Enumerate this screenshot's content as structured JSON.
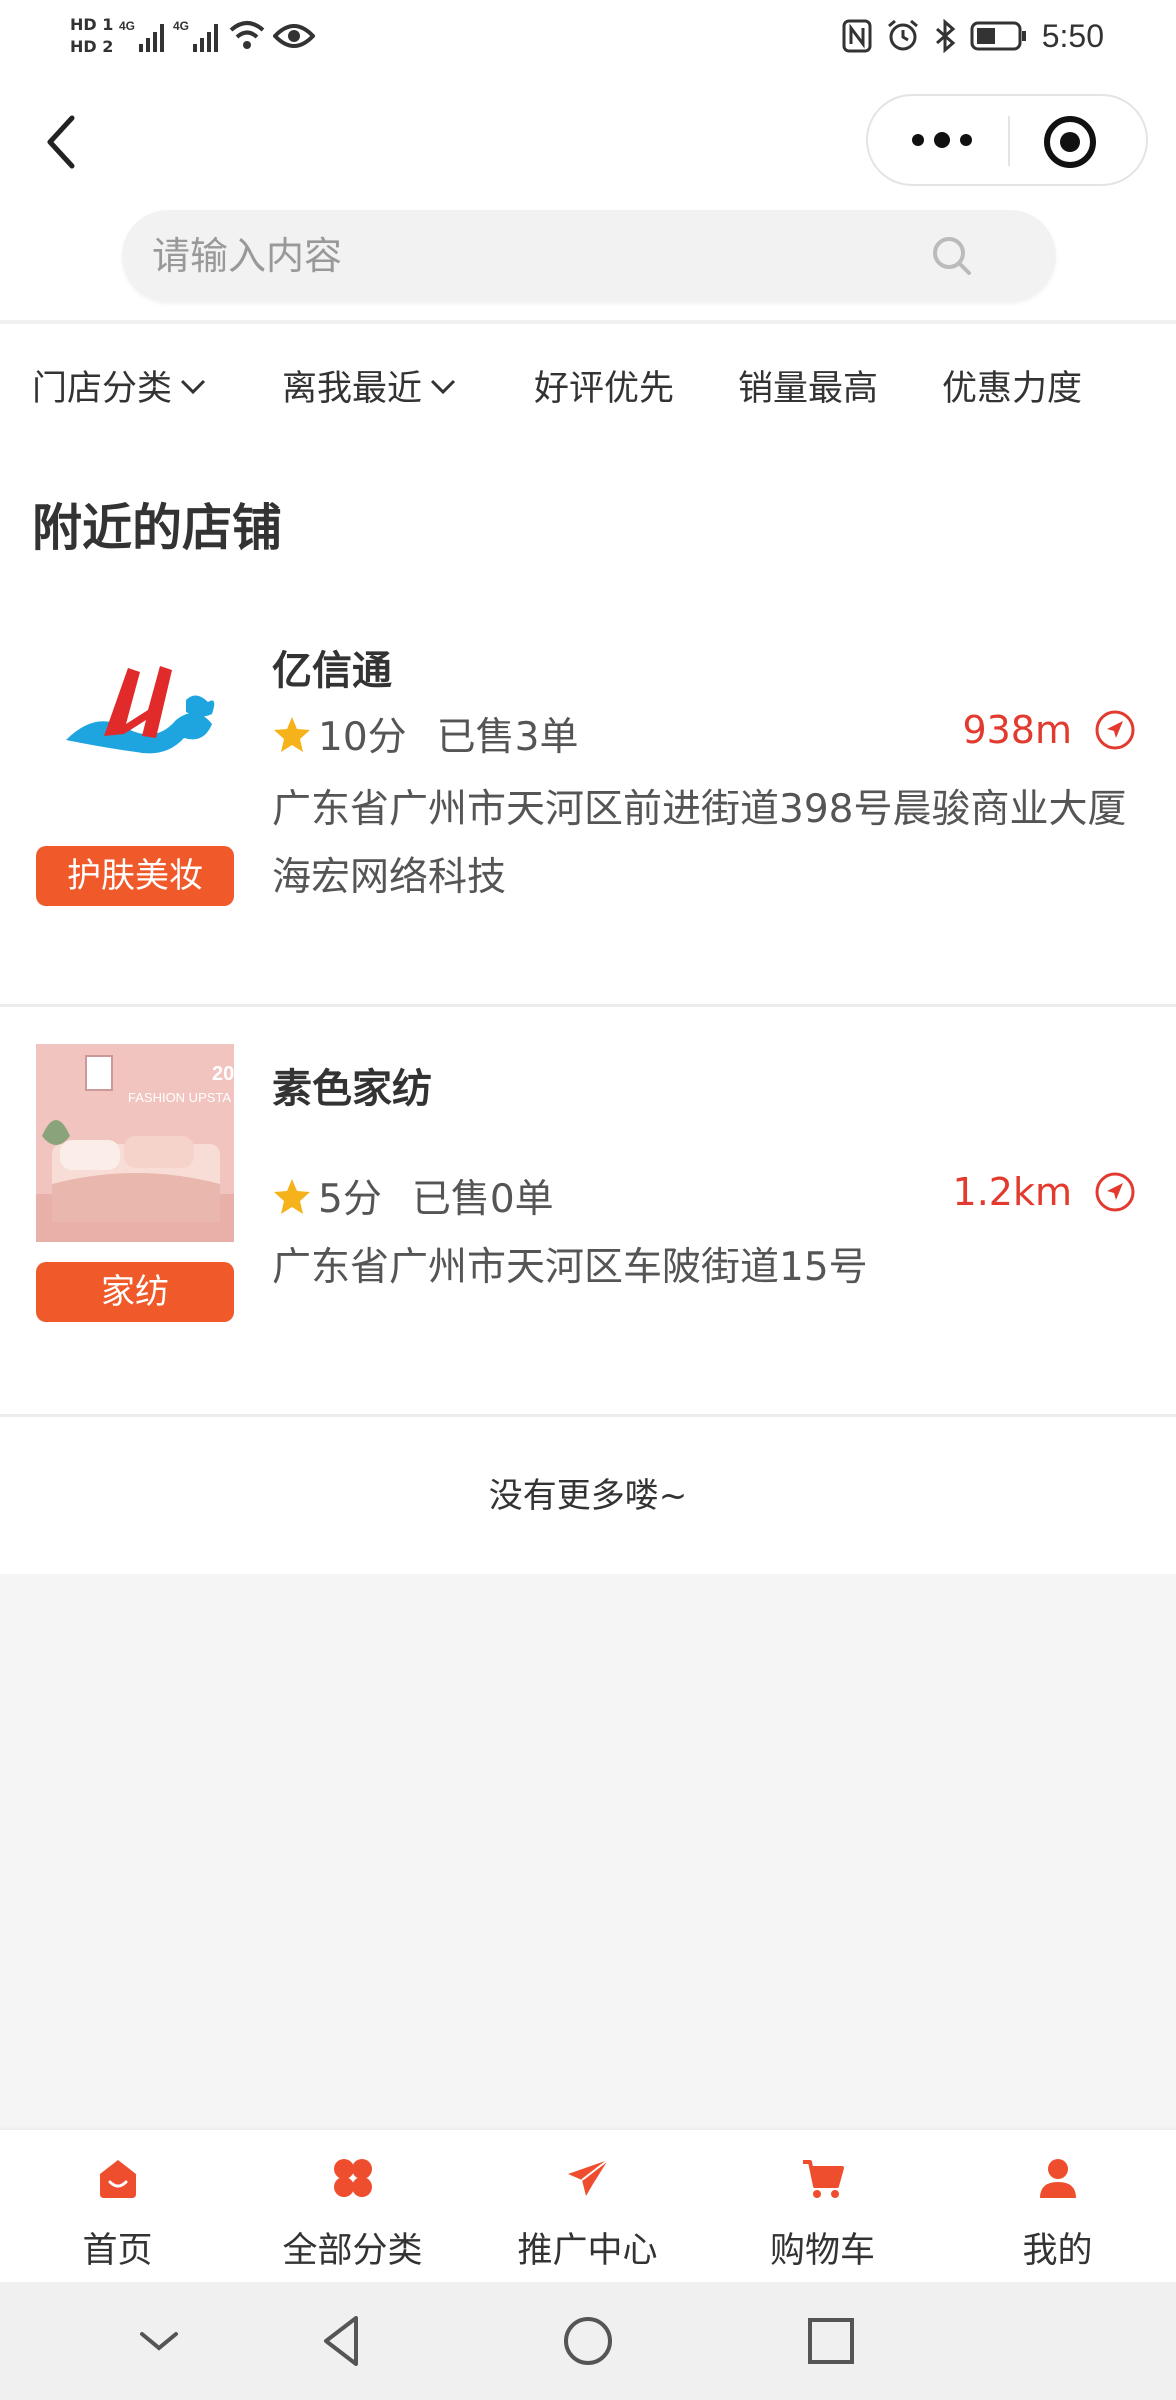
{
  "status_bar": {
    "sim1": "HD 1",
    "sim2": "HD 2",
    "signal1": "4G",
    "signal2": "4G",
    "time": "5:50",
    "icons": [
      "hd-icon",
      "signal-icon",
      "wifi-icon",
      "eye-icon",
      "nfc-icon",
      "alarm-icon",
      "bluetooth-icon",
      "battery-icon"
    ]
  },
  "nav": {
    "back_icon": "chevron-left-icon",
    "more_icon": "more-dots-icon",
    "close_icon": "target-icon"
  },
  "search": {
    "placeholder": "请输入内容",
    "icon": "search-icon"
  },
  "filters": [
    {
      "label": "门店分类",
      "has_dropdown": true
    },
    {
      "label": "离我最近",
      "has_dropdown": true
    },
    {
      "label": "好评优先",
      "has_dropdown": false
    },
    {
      "label": "销量最高",
      "has_dropdown": false
    },
    {
      "label": "优惠力度",
      "has_dropdown": false
    }
  ],
  "section_title": "附近的店铺",
  "shops": [
    {
      "name": "亿信通",
      "score": "10分",
      "sold": "已售3单",
      "distance": "938m",
      "address": "广东省广州市天河区前进街道398号晨骏商业大厦海宏网络科技",
      "tag": "护肤美妆"
    },
    {
      "name": "素色家纺",
      "score": "5分",
      "sold": "已售0单",
      "distance": "1.2km",
      "address": "广东省广州市天河区车陂街道15号",
      "tag": "家纺",
      "image_text": "20",
      "image_text2": "FASHION UPSTA"
    }
  ],
  "no_more_text": "没有更多喽~",
  "tabbar": [
    {
      "label": "首页",
      "icon": "home-icon"
    },
    {
      "label": "全部分类",
      "icon": "category-icon"
    },
    {
      "label": "推广中心",
      "icon": "paper-plane-icon"
    },
    {
      "label": "购物车",
      "icon": "cart-icon"
    },
    {
      "label": "我的",
      "icon": "user-icon"
    }
  ],
  "system_nav": [
    "collapse-icon",
    "back-triangle-icon",
    "home-circle-icon",
    "recents-square-icon"
  ],
  "colors": {
    "accent": "#f0592a",
    "distance": "#e23a2e",
    "star": "#f6b21b",
    "tab_icon": "#ee4e2e"
  }
}
